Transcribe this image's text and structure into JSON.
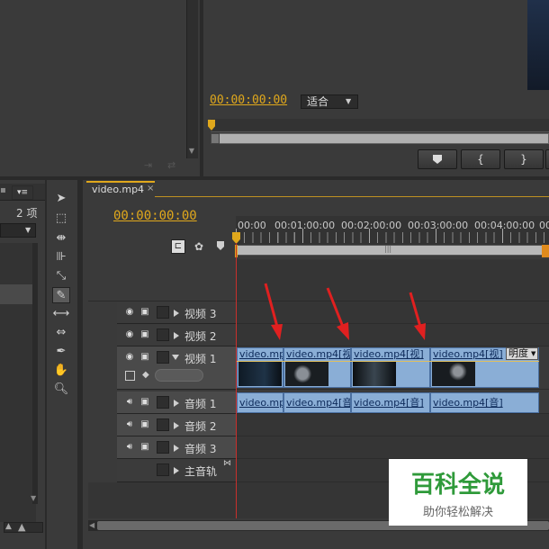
{
  "source_monitor": {},
  "program_monitor": {
    "timecode": "00:00:00:00",
    "fit_label": "适合",
    "controls": [
      "add-marker",
      "mark-in",
      "mark-out"
    ]
  },
  "project_panel": {
    "item_count": "2 项"
  },
  "sequence": {
    "tab_label": "video.mp4",
    "timecode": "00:00:00:00",
    "ruler": [
      "00:00",
      "00:01:00:00",
      "00:02:00:00",
      "00:03:00:00",
      "00:04:00:00",
      "00"
    ],
    "video_tracks": [
      {
        "name": "视频 3"
      },
      {
        "name": "视频 2"
      },
      {
        "name": "视频 1"
      }
    ],
    "audio_tracks": [
      {
        "name": "音频 1"
      },
      {
        "name": "音频 2"
      },
      {
        "name": "音频 3"
      }
    ],
    "master_track": "主音轨",
    "video_clips": [
      "video.mp",
      "video.mp4[视",
      "video.mp4[视]",
      "video.mp4[视]"
    ],
    "opacity_label": "明度",
    "audio_clips": [
      "video.mp",
      "video.mp4[音",
      "video.mp4[音]",
      "video.mp4[音]"
    ]
  },
  "watermark": {
    "title": "百科全说",
    "subtitle": "助你轻松解决"
  },
  "colors": {
    "timecode": "#e0a81c",
    "clip_fill": "#8aaed6",
    "playhead": "#c8302c",
    "arrow": "#e02020",
    "watermark_title": "#2f9a3a"
  }
}
